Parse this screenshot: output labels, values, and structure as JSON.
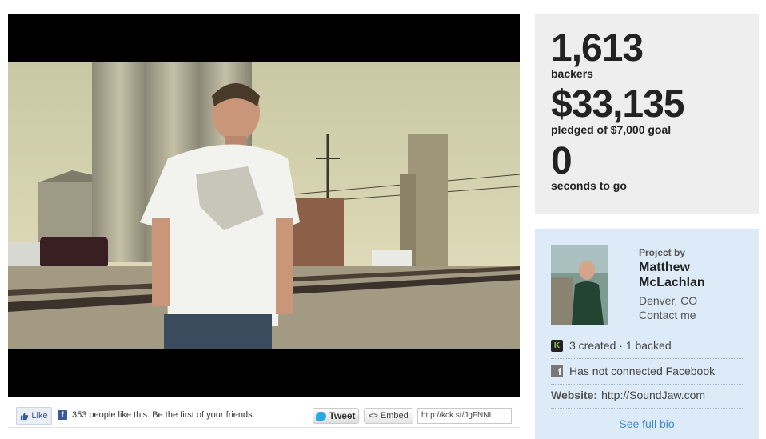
{
  "share": {
    "like_label": "Like",
    "like_text": "353 people like this. Be the first of your friends.",
    "tweet_label": "Tweet",
    "embed_label": "Embed",
    "short_url": "http://kck.st/JgFNNI"
  },
  "stats": {
    "backers_count": "1,613",
    "backers_label": "backers",
    "pledged_amount": "$33,135",
    "pledged_label": "pledged of $7,000 goal",
    "time_value": "0",
    "time_label": "seconds to go"
  },
  "creator": {
    "project_by": "Project by",
    "name": "Matthew McLachlan",
    "location": "Denver, CO",
    "contact": "Contact me",
    "created_backed": "3 created · 1 backed",
    "facebook": "Has not connected Facebook",
    "website_label": "Website:",
    "website_url": "http://SoundJaw.com",
    "bio_link": "See full bio"
  },
  "colors": {
    "stats_bg": "#eeeeee",
    "creator_bg": "#ddeaf8",
    "link": "#3c88c8",
    "facebook_blue": "#3b5998",
    "twitter_blue": "#2ba9e1",
    "kickstarter_green": "#8dc641"
  },
  "icons": [
    "play-video-icon",
    "facebook-thumb-icon",
    "facebook-icon",
    "twitter-bird-icon",
    "embed-code-icon",
    "kickstarter-icon"
  ]
}
